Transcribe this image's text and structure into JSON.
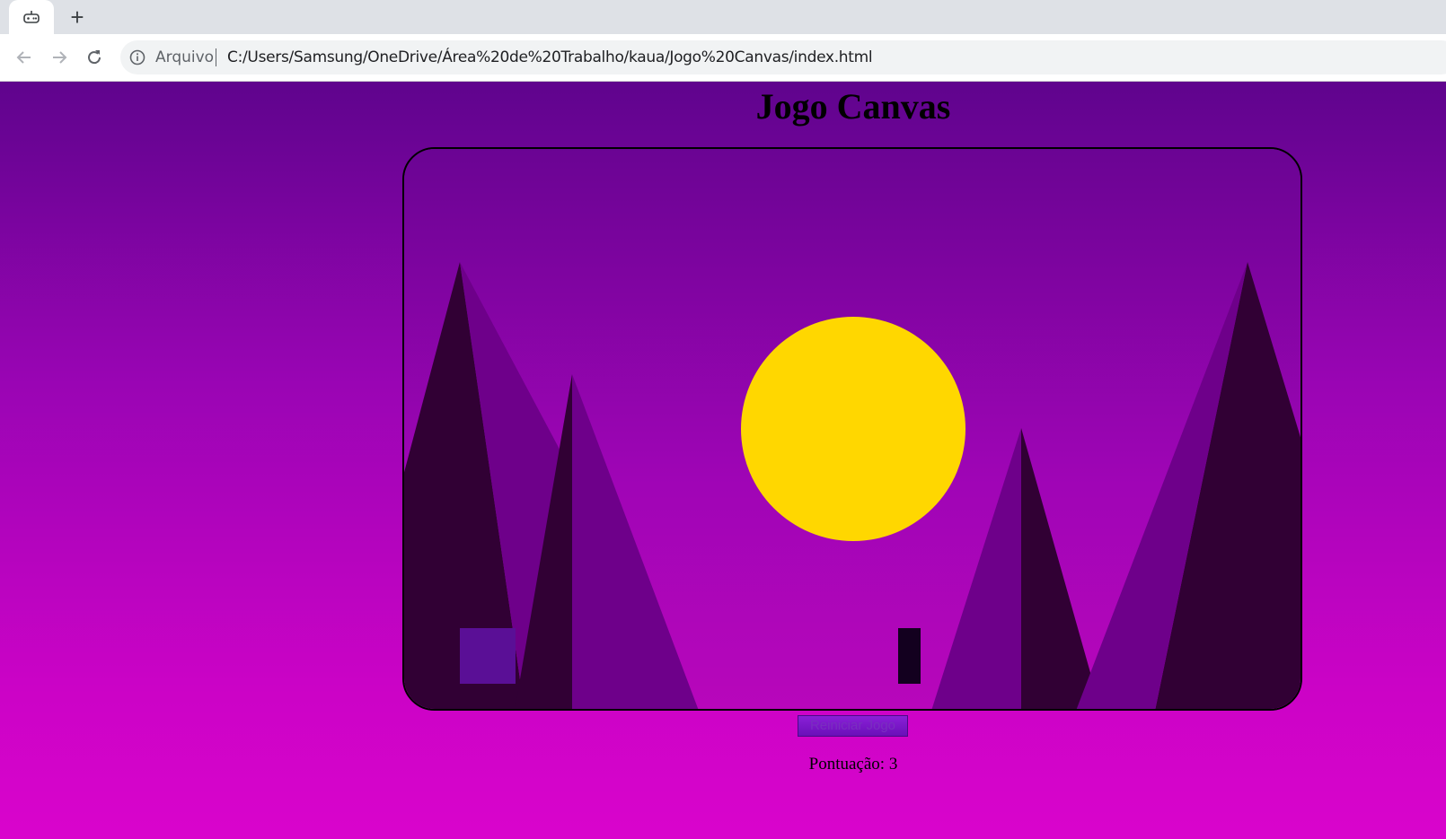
{
  "browser": {
    "tab_icon": "gamepad-icon",
    "new_tab_label": "+",
    "address": {
      "scheme_label": "Arquivo",
      "url": "C:/Users/Samsung/OneDrive/Área%20de%20Trabalho/kaua/Jogo%20Canvas/index.html"
    }
  },
  "page": {
    "title": "Jogo Canvas",
    "restart_button": "Reiniciar Jogo",
    "score_label": "Pontuação:",
    "score_value": "3"
  },
  "colors": {
    "sky_top": "#5f048d",
    "sky_bottom": "#d904cc",
    "sun": "#ffd700",
    "mountain_dark": "#310034",
    "mountain_mid": "#6e008a",
    "player": "#5a0f96",
    "obstacle": "#13001f"
  }
}
